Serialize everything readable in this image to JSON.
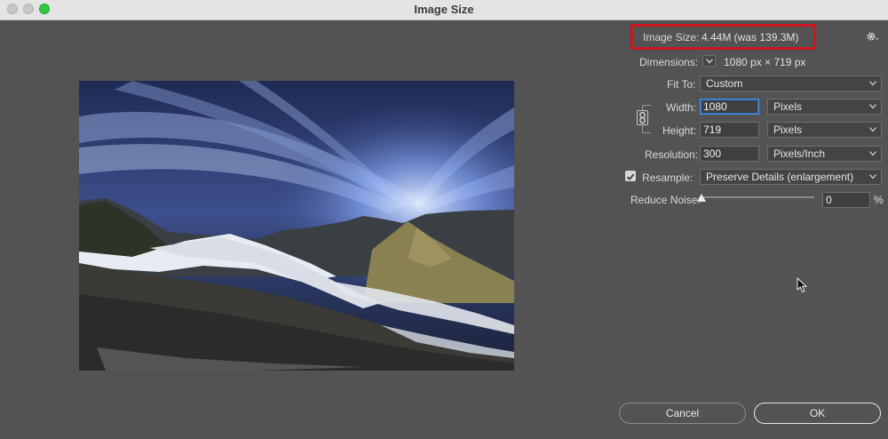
{
  "window": {
    "title": "Image Size"
  },
  "image_size": {
    "label": "Image Size:",
    "value": "4.44M (was 139.3M)"
  },
  "dimensions": {
    "label": "Dimensions:",
    "value": "1080 px  ×  719 px"
  },
  "fit_to": {
    "label": "Fit To:",
    "selected": "Custom"
  },
  "width": {
    "label": "Width:",
    "value": "1080",
    "unit": "Pixels"
  },
  "height": {
    "label": "Height:",
    "value": "719",
    "unit": "Pixels"
  },
  "resolution": {
    "label": "Resolution:",
    "value": "300",
    "unit": "Pixels/Inch"
  },
  "resample": {
    "label": "Resample:",
    "checked": true,
    "selected": "Preserve Details (enlargement)"
  },
  "reduce_noise": {
    "label": "Reduce Noise:",
    "value": "0",
    "unit": "%"
  },
  "buttons": {
    "cancel": "Cancel",
    "ok": "OK"
  },
  "icons": {
    "gear": "gear-icon",
    "link": "chain-link-icon",
    "chevron": "chevron-down-icon",
    "checkmark": "checkmark-icon",
    "cursor": "mouse-pointer-icon"
  },
  "colors": {
    "dialog_bg": "#535353",
    "highlight": "#d0151c",
    "focus": "#4a90e2"
  }
}
